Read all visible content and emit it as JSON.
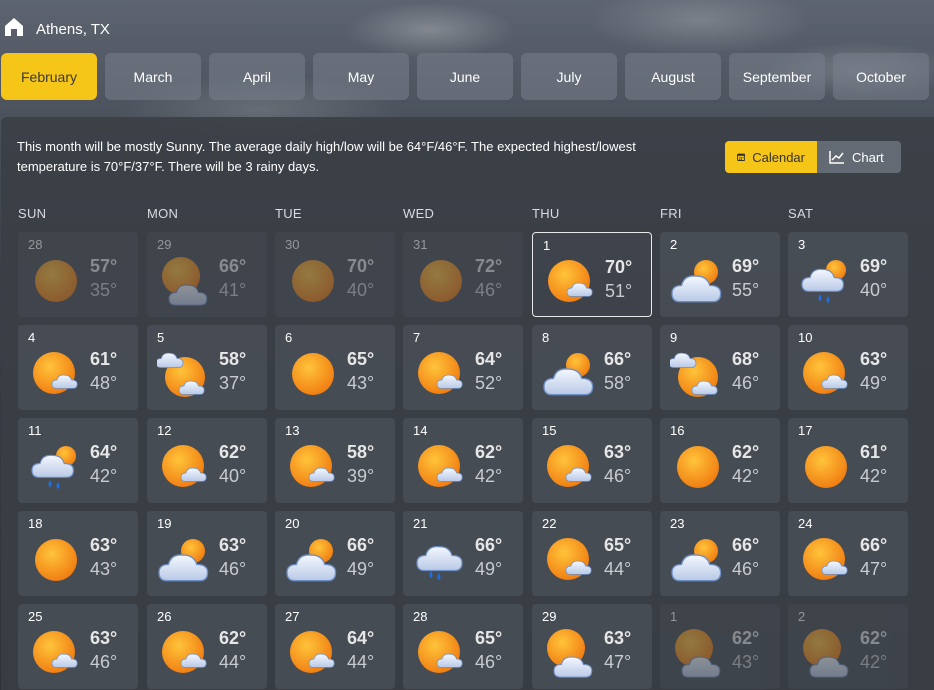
{
  "location": "Athens, TX",
  "months": [
    "February",
    "March",
    "April",
    "May",
    "June",
    "July",
    "August",
    "September",
    "October"
  ],
  "active_month": 0,
  "summary": "This month will be mostly Sunny. The average daily high/low will be 64°F/46°F. The expected highest/lowest temperature is 70°F/37°F. There will be 3 rainy days.",
  "view_toggle": {
    "calendar": "Calendar",
    "chart": "Chart",
    "active": "calendar"
  },
  "weekdays": [
    "SUN",
    "MON",
    "TUE",
    "WED",
    "THU",
    "FRI",
    "SAT"
  ],
  "days": [
    {
      "d": "28",
      "hi": "57°",
      "lo": "35°",
      "icon": "sun",
      "dim": true
    },
    {
      "d": "29",
      "hi": "66°",
      "lo": "41°",
      "icon": "sun-cloud",
      "dim": true
    },
    {
      "d": "30",
      "hi": "70°",
      "lo": "40°",
      "icon": "sun",
      "dim": true
    },
    {
      "d": "31",
      "hi": "72°",
      "lo": "46°",
      "icon": "sun",
      "dim": true
    },
    {
      "d": "1",
      "hi": "70°",
      "lo": "51°",
      "icon": "sun-small-cloud",
      "today": true
    },
    {
      "d": "2",
      "hi": "69°",
      "lo": "55°",
      "icon": "cloud-sun"
    },
    {
      "d": "3",
      "hi": "69°",
      "lo": "40°",
      "icon": "rain-sun"
    },
    {
      "d": "4",
      "hi": "61°",
      "lo": "48°",
      "icon": "sun-small-cloud"
    },
    {
      "d": "5",
      "hi": "58°",
      "lo": "37°",
      "icon": "sun-two-clouds"
    },
    {
      "d": "6",
      "hi": "65°",
      "lo": "43°",
      "icon": "sun"
    },
    {
      "d": "7",
      "hi": "64°",
      "lo": "52°",
      "icon": "sun-small-cloud"
    },
    {
      "d": "8",
      "hi": "66°",
      "lo": "58°",
      "icon": "cloud-sun"
    },
    {
      "d": "9",
      "hi": "68°",
      "lo": "46°",
      "icon": "sun-two-clouds"
    },
    {
      "d": "10",
      "hi": "63°",
      "lo": "49°",
      "icon": "sun-small-cloud"
    },
    {
      "d": "11",
      "hi": "64°",
      "lo": "42°",
      "icon": "rain-sun"
    },
    {
      "d": "12",
      "hi": "62°",
      "lo": "40°",
      "icon": "sun-small-cloud"
    },
    {
      "d": "13",
      "hi": "58°",
      "lo": "39°",
      "icon": "sun-small-cloud"
    },
    {
      "d": "14",
      "hi": "62°",
      "lo": "42°",
      "icon": "sun-small-cloud"
    },
    {
      "d": "15",
      "hi": "63°",
      "lo": "46°",
      "icon": "sun-small-cloud"
    },
    {
      "d": "16",
      "hi": "62°",
      "lo": "42°",
      "icon": "sun"
    },
    {
      "d": "17",
      "hi": "61°",
      "lo": "42°",
      "icon": "sun"
    },
    {
      "d": "18",
      "hi": "63°",
      "lo": "43°",
      "icon": "sun"
    },
    {
      "d": "19",
      "hi": "63°",
      "lo": "46°",
      "icon": "cloud-sun"
    },
    {
      "d": "20",
      "hi": "66°",
      "lo": "49°",
      "icon": "cloud-sun"
    },
    {
      "d": "21",
      "hi": "66°",
      "lo": "49°",
      "icon": "rain"
    },
    {
      "d": "22",
      "hi": "65°",
      "lo": "44°",
      "icon": "sun-small-cloud"
    },
    {
      "d": "23",
      "hi": "66°",
      "lo": "46°",
      "icon": "cloud-sun"
    },
    {
      "d": "24",
      "hi": "66°",
      "lo": "47°",
      "icon": "sun-small-cloud"
    },
    {
      "d": "25",
      "hi": "63°",
      "lo": "46°",
      "icon": "sun-small-cloud"
    },
    {
      "d": "26",
      "hi": "62°",
      "lo": "44°",
      "icon": "sun-small-cloud"
    },
    {
      "d": "27",
      "hi": "64°",
      "lo": "44°",
      "icon": "sun-small-cloud"
    },
    {
      "d": "28",
      "hi": "65°",
      "lo": "46°",
      "icon": "sun-small-cloud"
    },
    {
      "d": "29",
      "hi": "63°",
      "lo": "47°",
      "icon": "sun-cloud"
    },
    {
      "d": "1",
      "hi": "62°",
      "lo": "43°",
      "icon": "sun-cloud",
      "dim": true
    },
    {
      "d": "2",
      "hi": "62°",
      "lo": "42°",
      "icon": "sun-cloud",
      "dim": true
    }
  ]
}
